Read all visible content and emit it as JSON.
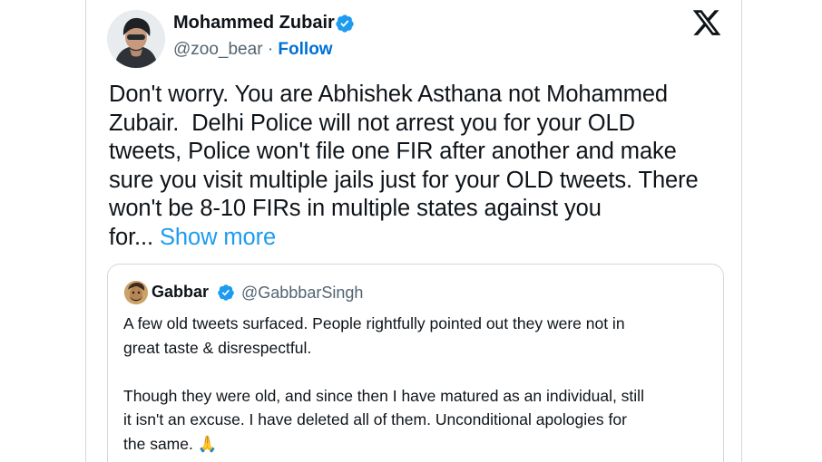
{
  "tweet": {
    "author_name": "Mohammed Zubair",
    "handle": "@zoo_bear",
    "separator": "·",
    "follow_label": "Follow",
    "text_lines": [
      "Don't worry. You are Abhishek Asthana not Mohammed",
      "Zubair.  Delhi Police will not arrest you for your OLD",
      "tweets, Police won't file one FIR after another and make",
      "sure you visit multiple jails just for your OLD tweets. There",
      "won't be 8-10 FIRs in multiple states against you",
      "for..."
    ],
    "show_more_label": "Show more"
  },
  "quoted_tweet": {
    "author_name": "Gabbar",
    "handle": "@GabbbarSingh",
    "paragraph_1_lines": [
      "A few old tweets surfaced. People rightfully pointed out they were not in",
      "great taste & disrespectful."
    ],
    "paragraph_2_lines": [
      "Though they were old, and since then I have matured as an individual, still",
      "it isn't an excuse. I have deleted all of them. Unconditional apologies for",
      "the same."
    ],
    "emoji": "🙏"
  },
  "icons": {
    "platform_logo": "x-logo-icon",
    "verified": "verified-badge-icon"
  },
  "colors": {
    "link_blue": "#1d9bf0",
    "follow_blue": "#006fd6",
    "text_primary": "#0f1419",
    "text_secondary": "#536471",
    "border": "#cfd9de"
  }
}
